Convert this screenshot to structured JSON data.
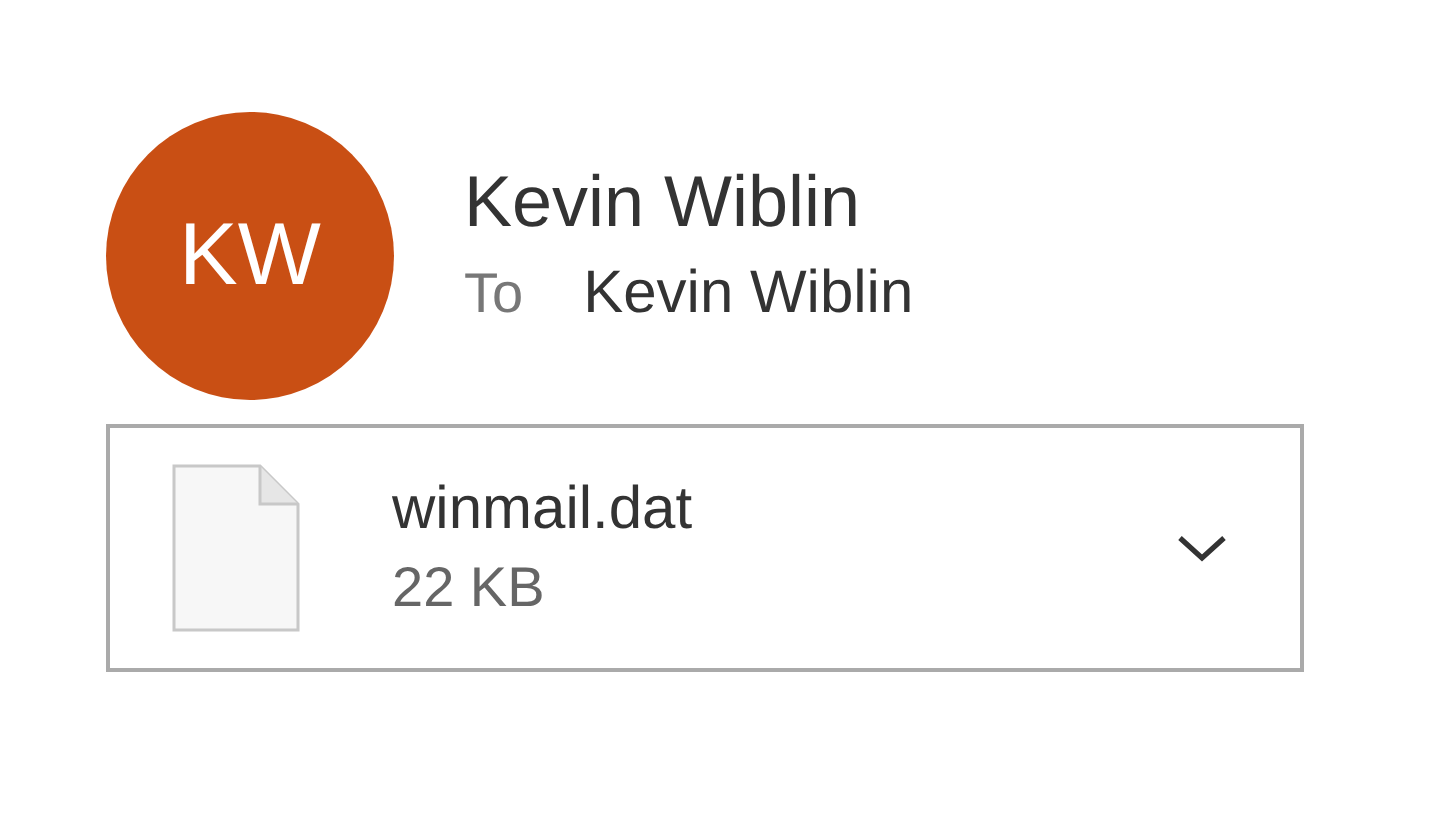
{
  "sender": {
    "initials": "KW",
    "name": "Kevin Wiblin"
  },
  "recipient": {
    "label": "To",
    "name": "Kevin Wiblin"
  },
  "attachments": [
    {
      "filename": "winmail.dat",
      "size": "22 KB"
    }
  ]
}
